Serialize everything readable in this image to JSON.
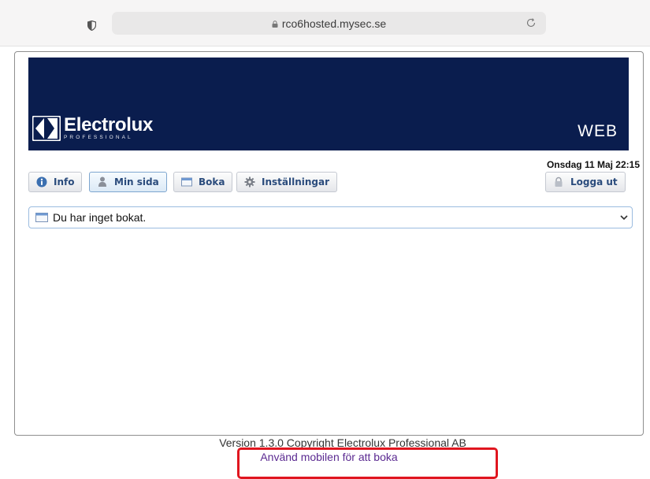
{
  "browser": {
    "url": "rco6hosted.mysec.se"
  },
  "header": {
    "logo_name": "Electrolux",
    "logo_sub": "PROFESSIONAL",
    "web_label": "WEB",
    "brand_color": "#0a1d4e"
  },
  "status": {
    "datetime": "Onsdag 11 Maj 22:15"
  },
  "nav": {
    "items": [
      {
        "label": "Info",
        "icon": "info-icon"
      },
      {
        "label": "Min sida",
        "icon": "user-icon",
        "active": true
      },
      {
        "label": "Boka",
        "icon": "calendar-icon"
      },
      {
        "label": "Inställningar",
        "icon": "gear-icon"
      }
    ],
    "logout_label": "Logga ut"
  },
  "booking_select": {
    "value": "Du har inget bokat."
  },
  "footer": {
    "version_text": "Version 1.3.0 Copyright Electrolux Professional AB",
    "mobile_link": "Använd mobilen för att boka",
    "highlight_color": "#e0161f"
  }
}
